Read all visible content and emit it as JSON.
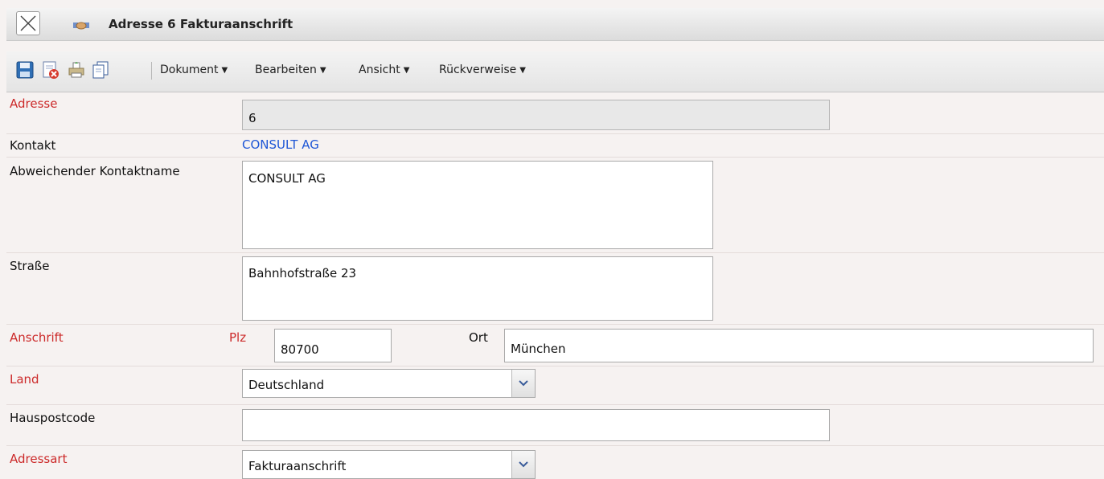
{
  "window": {
    "title": "Adresse 6 Fakturaanschrift"
  },
  "toolbar": {
    "menus": [
      "Dokument",
      "Bearbeiten",
      "Ansicht",
      "Rückverweise"
    ]
  },
  "form": {
    "adresse": {
      "label": "Adresse",
      "value": "6"
    },
    "kontakt": {
      "label": "Kontakt",
      "value": "CONSULT AG"
    },
    "kontaktname": {
      "label": "Abweichender Kontaktname",
      "value": "CONSULT AG"
    },
    "strasse": {
      "label": "Straße",
      "value": "Bahnhofstraße 23"
    },
    "anschrift": {
      "label": "Anschrift",
      "plz_label": "Plz",
      "plz_value": "80700",
      "ort_label": "Ort",
      "ort_value": "München"
    },
    "land": {
      "label": "Land",
      "value": "Deutschland"
    },
    "hauspostcode": {
      "label": "Hauspostcode",
      "value": ""
    },
    "adressart": {
      "label": "Adressart",
      "value": "Fakturaanschrift"
    }
  },
  "colors": {
    "required_label": "#cc2a2a",
    "link": "#1e56d6",
    "background": "#f6f2f1"
  }
}
